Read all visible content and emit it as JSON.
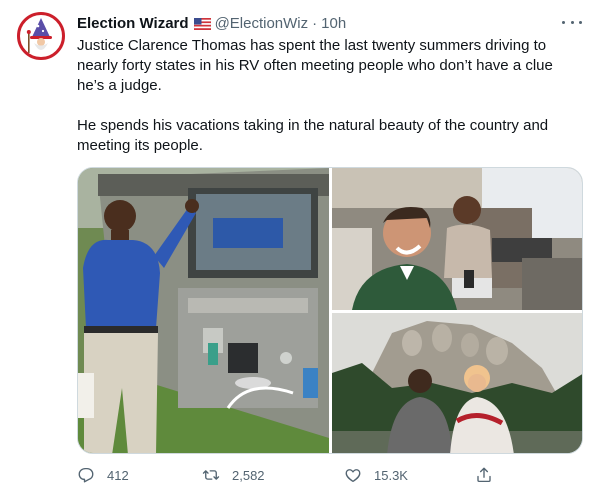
{
  "tweet": {
    "display_name": "Election Wizard",
    "flag_icon": "us-flag-icon",
    "handle": "@ElectionWiz",
    "separator": "·",
    "time": "10h",
    "paragraphs": [
      "Justice Clarence Thomas has spent the last twenty summers driving to nearly forty states in his RV often meeting people who don’t have a clue he’s a judge.",
      "He spends his vacations taking in the natural beauty of the country and meeting its people."
    ],
    "photos": [
      "rv-exterior-photo",
      "rv-interior-photo",
      "mount-rushmore-photo"
    ],
    "stats": {
      "replies": "412",
      "retweets": "2,582",
      "likes": "15.3K"
    }
  },
  "colors": {
    "text": "#0f1419",
    "secondary": "#536471",
    "border": "#cfd9de",
    "avatar_ring": "#cc1f2b"
  },
  "icons": [
    "wizard-avatar",
    "more-options-icon",
    "reply-icon",
    "retweet-icon",
    "like-icon",
    "share-icon"
  ]
}
